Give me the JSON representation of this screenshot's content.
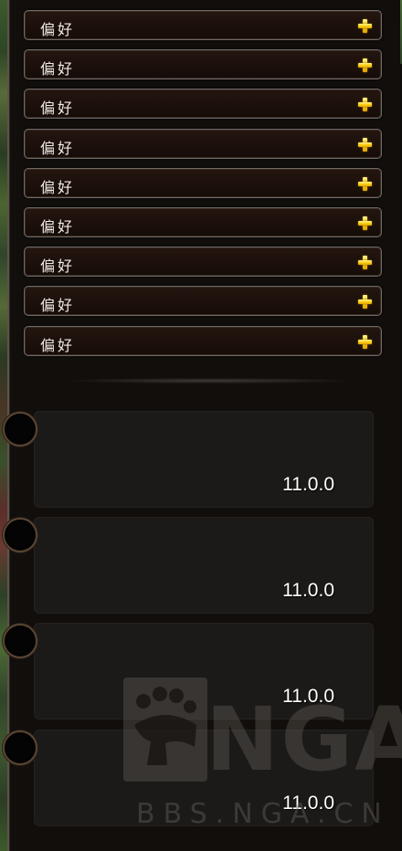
{
  "preferences": {
    "items": [
      {
        "label": "偏好"
      },
      {
        "label": "偏好"
      },
      {
        "label": "偏好"
      },
      {
        "label": "偏好"
      },
      {
        "label": "偏好"
      },
      {
        "label": "偏好"
      },
      {
        "label": "偏好"
      },
      {
        "label": "偏好"
      },
      {
        "label": "偏好"
      }
    ],
    "add_icon": "plus-icon",
    "accent_color": "#ffd51a"
  },
  "cards": [
    {
      "version": "11.0.0"
    },
    {
      "version": "11.0.0"
    },
    {
      "version": "11.0.0"
    },
    {
      "version": "11.0.0"
    }
  ],
  "watermark": {
    "brand": "NGA",
    "url": "BBS.NGA.CN",
    "icon": "paw-logo"
  }
}
